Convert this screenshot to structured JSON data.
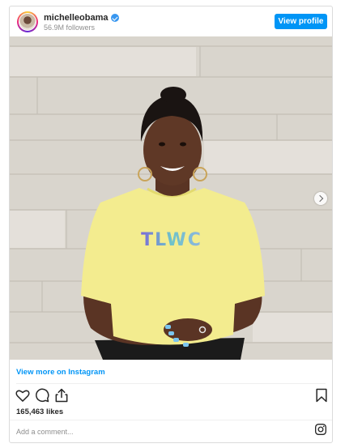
{
  "post": {
    "username": "michelleobama",
    "followers": "56.9M followers",
    "view_profile_label": "View profile",
    "photo_shirt_text": "TLWC",
    "view_more_label": "View more on Instagram",
    "likes": "165,463 likes",
    "comment_placeholder": "Add a comment..."
  },
  "icons": {
    "verified": "verified-badge-icon",
    "like": "heart-icon",
    "comment": "comment-bubble-icon",
    "share": "share-icon",
    "save": "bookmark-icon",
    "instagram": "instagram-logo-icon",
    "next": "chevron-right-icon"
  },
  "colors": {
    "accent": "#0095f6",
    "text": "#262626",
    "muted": "#8e8e8e",
    "shirt": "#f3ec8f",
    "wall": "#d9d5cd"
  }
}
